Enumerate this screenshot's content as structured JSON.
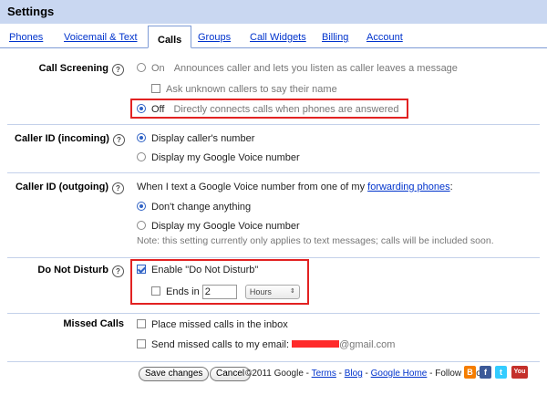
{
  "header": {
    "title": "Settings"
  },
  "tabs": [
    {
      "label": "Phones"
    },
    {
      "label": "Voicemail & Text"
    },
    {
      "label": "Calls"
    },
    {
      "label": "Groups"
    },
    {
      "label": "Call Widgets"
    },
    {
      "label": "Billing"
    },
    {
      "label": "Account"
    }
  ],
  "help_glyph": "?",
  "call_screening": {
    "label": "Call Screening",
    "on_label": "On",
    "on_desc": "Announces caller and lets you listen as caller leaves a message",
    "ask_name": "Ask unknown callers to say their name",
    "off_label": "Off",
    "off_desc": "Directly connects calls when phones are answered"
  },
  "caller_id_incoming": {
    "label": "Caller ID (incoming)",
    "opt1": "Display caller's number",
    "opt2": "Display my Google Voice number"
  },
  "caller_id_outgoing": {
    "label": "Caller ID (outgoing)",
    "intro": "When I text a Google Voice number from one of my",
    "intro_link": "forwarding phones",
    "intro_end": ":",
    "opt1": "Don't change anything",
    "opt2": "Display my Google Voice number",
    "note": "Note: this setting currently only applies to text messages; calls will be included soon."
  },
  "do_not_disturb": {
    "label": "Do Not Disturb",
    "enable": "Enable \"Do Not Disturb\"",
    "ends_in": "Ends in",
    "ends_value": "2",
    "unit": "Hours",
    "unit_arrow": "⇕"
  },
  "missed_calls": {
    "label": "Missed Calls",
    "opt1": "Place missed calls in the inbox",
    "opt2": "Send missed calls to my email:",
    "email_domain": "@gmail.com"
  },
  "footer": {
    "save": "Save changes",
    "cancel": "Cancel",
    "copyright": "©2011 Google -",
    "terms": "Terms",
    "sep1": " - ",
    "blog": "Blog",
    "sep2": " - ",
    "home": "Google Home",
    "follow": " - Follow us on:",
    "blogger_glyph": "B",
    "facebook_glyph": "f",
    "twitter_glyph": "t",
    "youtube_glyph": "You"
  },
  "colors": {
    "header_bg": "#c9d7f1",
    "link": "#0033cc",
    "highlight": "#e22222",
    "accent": "#2f62c5"
  }
}
